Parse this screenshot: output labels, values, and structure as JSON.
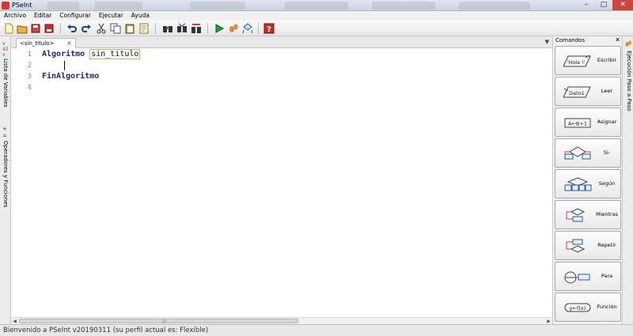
{
  "window": {
    "title": "PSeInt"
  },
  "menu": [
    "Archivo",
    "Editar",
    "Configurar",
    "Ejecutar",
    "Ayuda"
  ],
  "toolbar_icons": [
    "new-file-icon",
    "open-file-icon",
    "save-icon",
    "save-as-icon",
    "undo-icon",
    "redo-icon",
    "cut-icon",
    "copy-icon",
    "paste-icon",
    "edit-icon",
    "find-icon",
    "find-next-icon",
    "replace-icon",
    "run-icon",
    "step-icon",
    "flowchart-icon",
    "help-icon"
  ],
  "left_tabs": {
    "variables": "Lista de Variables",
    "operators": "Operadores y Funciones"
  },
  "editor": {
    "tab_label": "<sin_titulo>",
    "line_numbers": [
      "1",
      "2",
      "3",
      "4"
    ],
    "line1_keyword": "Algoritmo",
    "line1_name": "sin_titulo",
    "line3_keyword": "FinAlgoritmo"
  },
  "commands": {
    "title": "Comandos",
    "buttons": [
      {
        "label": "Escribir",
        "glyph_text": "'Hola !'"
      },
      {
        "label": "Leer",
        "glyph_text": "Dato1"
      },
      {
        "label": "Asignar",
        "glyph_text": "A←B+1"
      },
      {
        "label": "Si-Entonces",
        "glyph_text": ""
      },
      {
        "label": "Según",
        "glyph_text": ""
      },
      {
        "label": "Mientras",
        "glyph_text": ""
      },
      {
        "label": "Repetir",
        "glyph_text": ""
      },
      {
        "label": "Para",
        "glyph_text": ""
      },
      {
        "label": "Función",
        "glyph_text": "y←f(x)"
      }
    ]
  },
  "right_tab": {
    "label": "Ejecución Paso a Paso"
  },
  "status": {
    "text": "Bienvenido a PSeInt v20190311 (su perfil actual es: Flexible)"
  },
  "colors": {
    "keyword": "#1b2a6b",
    "accent_red": "#c9473d"
  }
}
